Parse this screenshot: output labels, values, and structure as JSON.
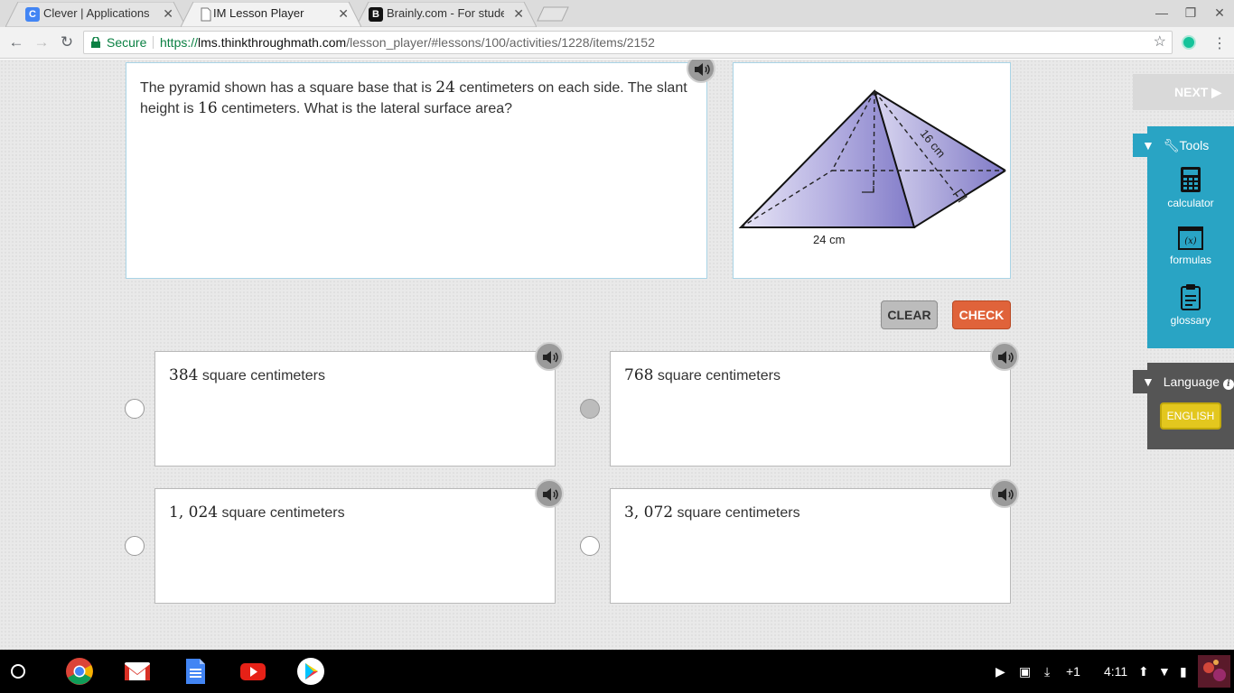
{
  "browser": {
    "tabs": [
      {
        "title": "Clever | Applications",
        "favicon": "C",
        "favicon_color": "#4285f4"
      },
      {
        "title": "IM Lesson Player",
        "favicon": "",
        "favicon_color": "#ffffff"
      },
      {
        "title": "Brainly.com - For students",
        "favicon": "B",
        "favicon_color": "#111111"
      }
    ],
    "secure_label": "Secure",
    "url": {
      "scheme": "https://",
      "host": "lms.thinkthroughmath.com",
      "path": "/lesson_player/#lessons/100/activities/1228/items/2152"
    }
  },
  "question": {
    "part1": "The pyramid shown has a square base that is ",
    "base": "24",
    "part2": " centimeters on each side. The slant height is ",
    "slant": "16",
    "part3": " centimeters. What is the lateral surface area?"
  },
  "figure": {
    "base_label": "24 cm",
    "slant_label": "16 cm"
  },
  "buttons": {
    "clear": "CLEAR",
    "check": "CHECK",
    "next": "NEXT ▶"
  },
  "choices": [
    {
      "value": "384",
      "unit": " square centimeters"
    },
    {
      "value": "768",
      "unit": " square centimeters"
    },
    {
      "value": "1, 024",
      "unit": " square centimeters"
    },
    {
      "value": "3, 072",
      "unit": " square centimeters"
    }
  ],
  "tools": {
    "header": "Tools",
    "items": [
      "calculator",
      "formulas",
      "glossary"
    ]
  },
  "language": {
    "header": "Language",
    "button": "ENGLISH"
  },
  "shelf": {
    "notifications": "+1",
    "time": "4:11"
  },
  "colors": {
    "accent": "#29a4c4",
    "check": "#e0633a",
    "english": "#e3c71e",
    "secure": "#0b8043"
  }
}
